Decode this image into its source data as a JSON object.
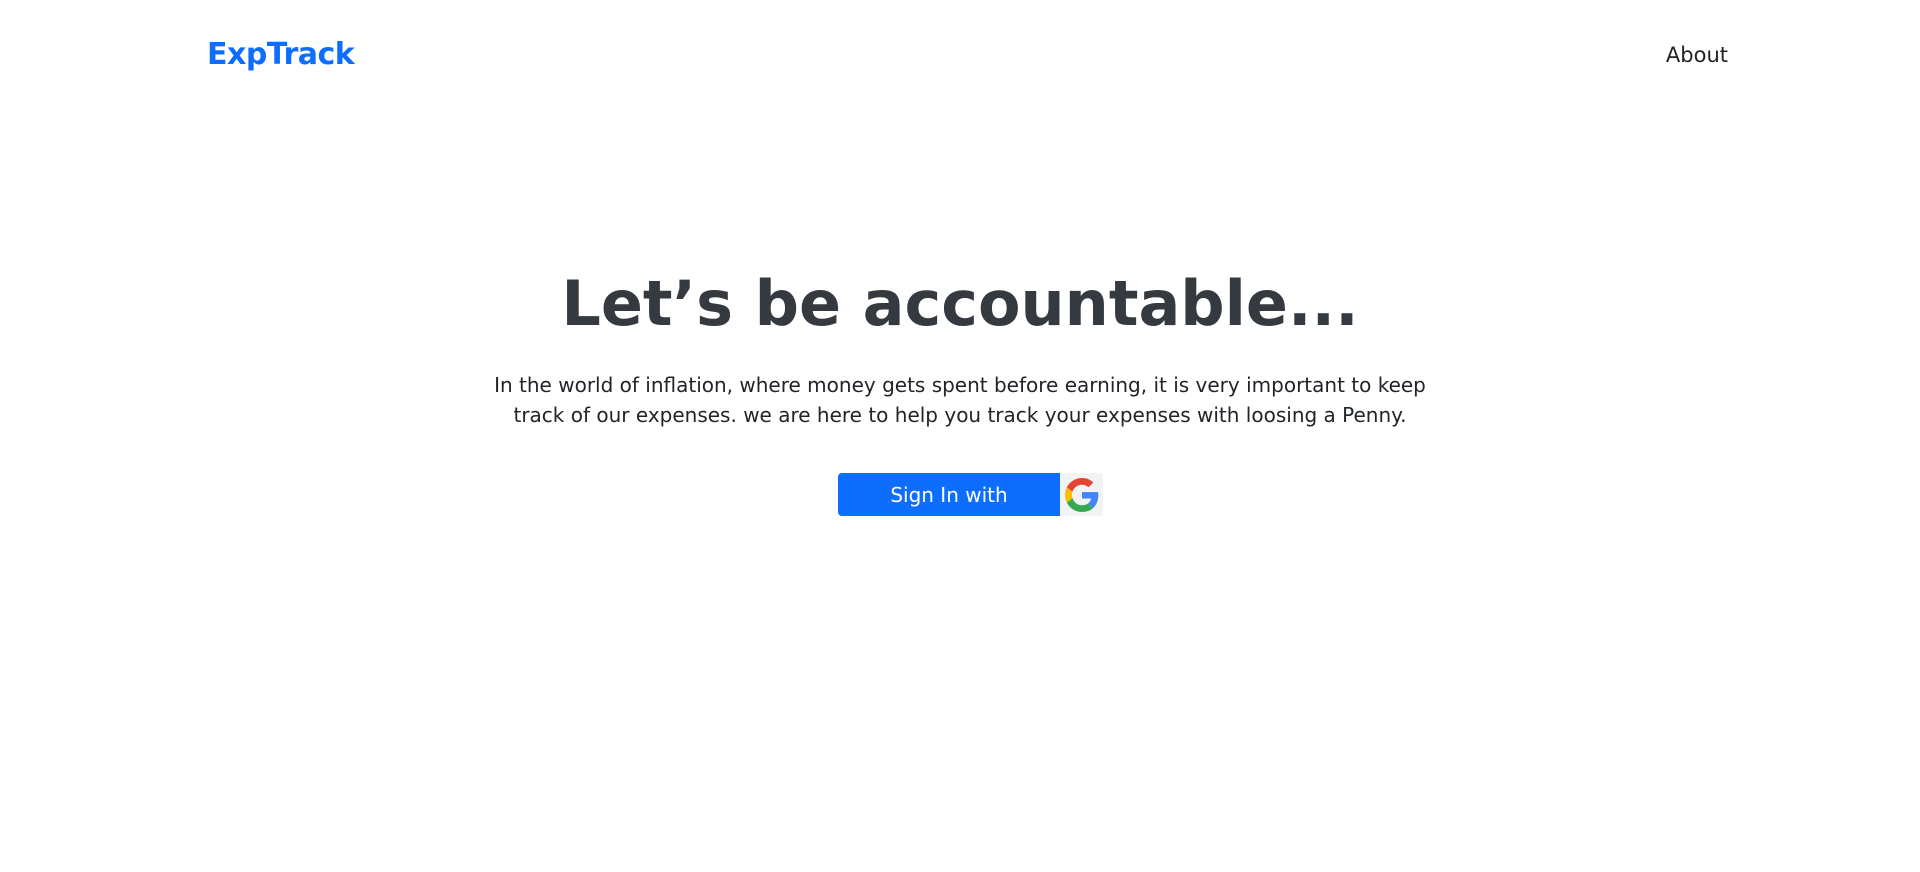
{
  "header": {
    "brand": "ExpTrack",
    "nav_about": "About"
  },
  "hero": {
    "title": "Let’s be accountable...",
    "description": "In the world of inflation, where money gets spent before earning, it is very important to keep track of our expenses. we are here to help you track your expenses with loosing a Penny.",
    "signin_label": "Sign In with",
    "signin_icon": "google-icon"
  },
  "colors": {
    "brand": "#0d6efd",
    "title": "#343a40",
    "button": "#0d6efd"
  }
}
